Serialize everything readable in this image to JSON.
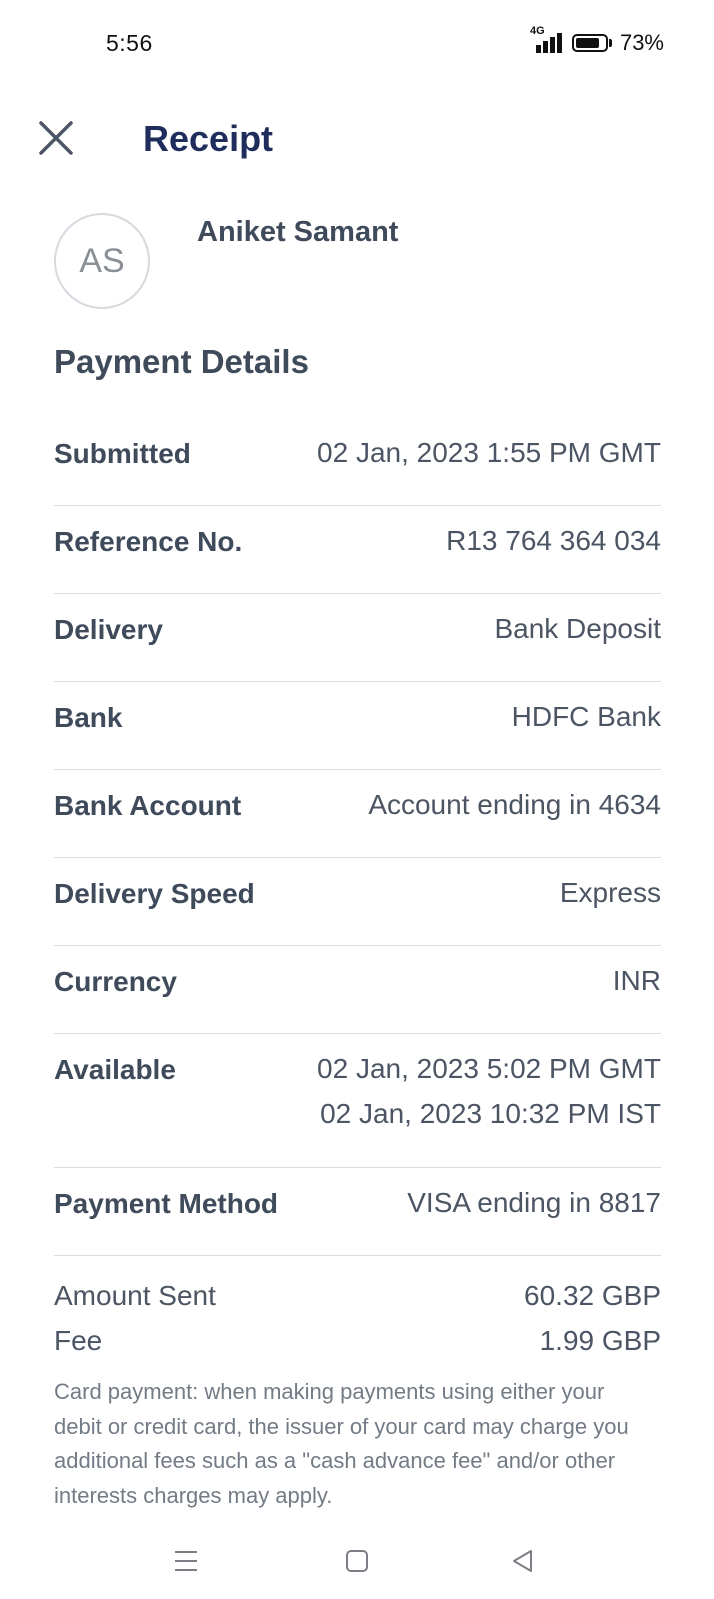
{
  "status_bar": {
    "time": "5:56",
    "network": "4G",
    "battery": "73%"
  },
  "header": {
    "close_icon": "close-icon",
    "title": "Receipt"
  },
  "recipient": {
    "initials": "AS",
    "name": "Aniket Samant"
  },
  "section_title": "Payment Details",
  "details": [
    {
      "label": "Submitted",
      "value": "02 Jan, 2023 1:55 PM GMT"
    },
    {
      "label": "Reference No.",
      "value": "R13 764 364 034"
    },
    {
      "label": "Delivery",
      "value": "Bank Deposit"
    },
    {
      "label": "Bank",
      "value": "HDFC Bank"
    },
    {
      "label": "Bank Account",
      "value": "Account ending in 4634"
    },
    {
      "label": "Delivery Speed",
      "value": "Express"
    },
    {
      "label": "Currency",
      "value": "INR"
    },
    {
      "label": "Available",
      "value": "02 Jan, 2023 5:02 PM GMT",
      "value2": "02 Jan, 2023 10:32 PM IST"
    },
    {
      "label": "Payment Method",
      "value": "VISA ending in 8817"
    }
  ],
  "amounts": [
    {
      "label": "Amount Sent",
      "value": "60.32 GBP"
    },
    {
      "label": "Fee",
      "value": "1.99 GBP"
    }
  ],
  "note": "Card payment: when making payments using either your debit or credit card, the issuer of your card may charge you additional fees such as a \"cash advance fee\" and/or other interests charges may apply.",
  "nav": {
    "menu_icon": "menu-icon",
    "home_icon": "home-square-icon",
    "back_icon": "back-triangle-icon"
  },
  "colors": {
    "title": "#1f2d5c",
    "label": "#3f4a5a",
    "value": "#4b5563",
    "divider": "#d9dde2",
    "note": "#737b86"
  }
}
